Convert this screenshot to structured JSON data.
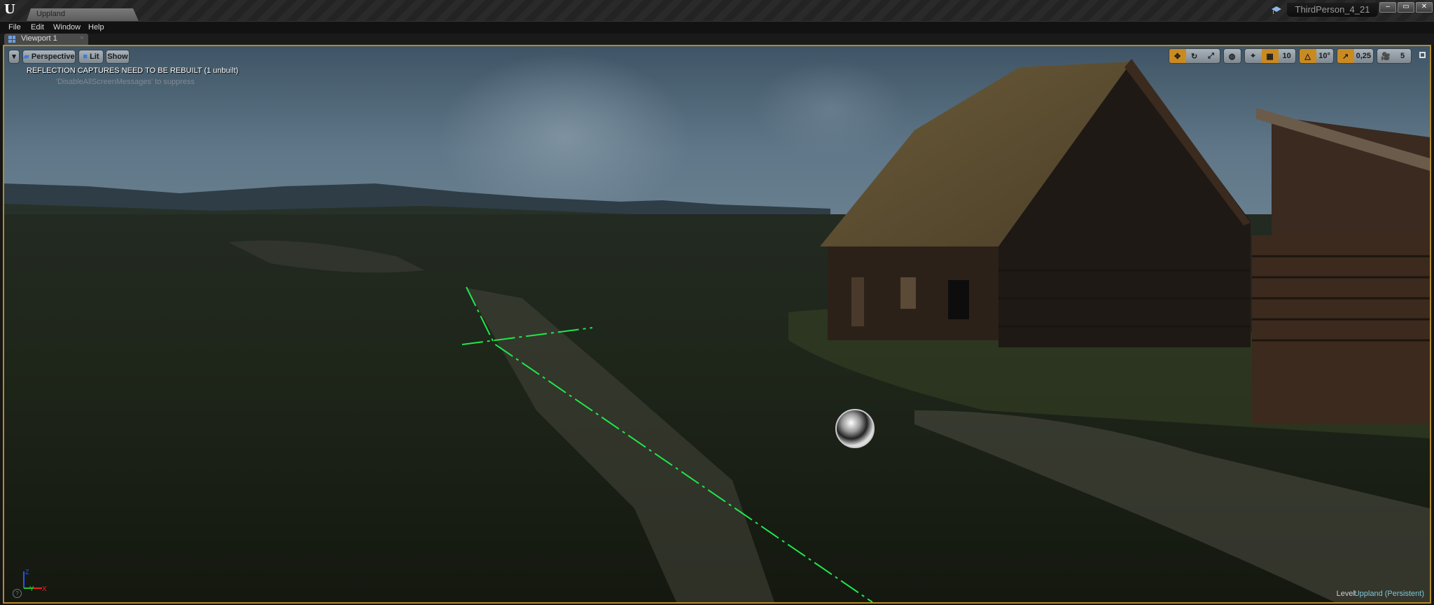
{
  "app": {
    "logo_icon": "unreal-engine-logo",
    "document_tab": "Uppland",
    "project_name": "ThirdPerson_4_21",
    "window_controls": {
      "minimize": "–",
      "maximize": "▭",
      "close": "✕"
    }
  },
  "menu": [
    "File",
    "Edit",
    "Window",
    "Help"
  ],
  "tabs": [
    {
      "label": "Viewport 1",
      "close": "×"
    }
  ],
  "viewport": {
    "toolbar_left": {
      "options_dropdown": "▾",
      "view_mode": "Perspective",
      "lighting_mode": "Lit",
      "show": "Show"
    },
    "messages": {
      "warning": "REFLECTION CAPTURES NEED TO BE REBUILT (1 unbuilt)",
      "hint": "'DisableAllScreenMessages' to suppress"
    },
    "toolbar_right": {
      "transform_modes": [
        "translate",
        "rotate",
        "scale"
      ],
      "active_transform": "translate",
      "coordinate_space": "world",
      "surface_snapping": "off",
      "grid_snap": {
        "enabled": true,
        "value": "10"
      },
      "rotation_snap": {
        "enabled": true,
        "value": "10°"
      },
      "scale_snap": {
        "enabled": true,
        "value": "0,25"
      },
      "camera_speed": "5"
    },
    "axis_gizmo": {
      "z": "Z",
      "y": "Y",
      "x": "X"
    },
    "level": {
      "label": "Level:",
      "value": "Uppland (Persistent)"
    },
    "accent_color": "#c98a22",
    "frame_color": "#b38b2e"
  }
}
